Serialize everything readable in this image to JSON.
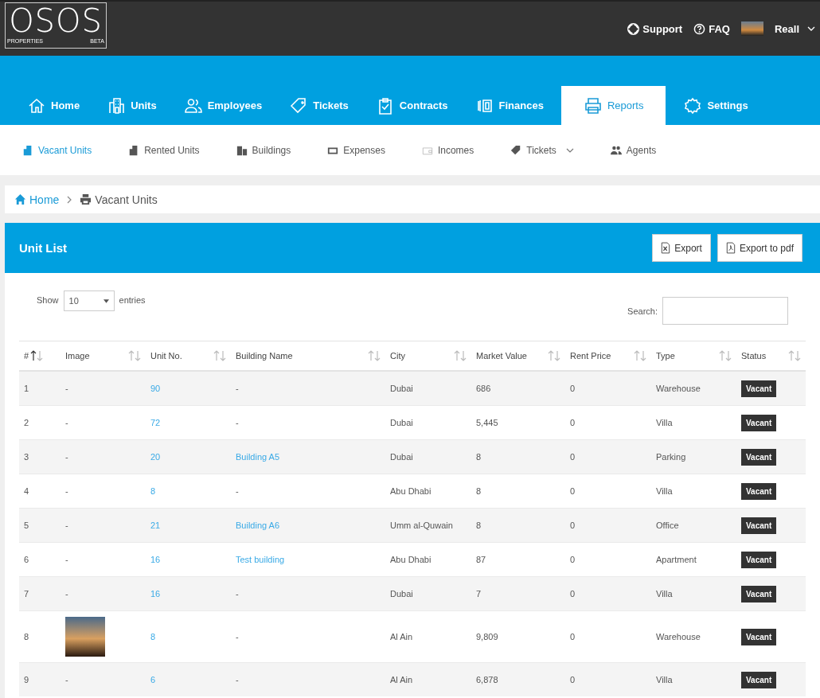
{
  "logo": {
    "name": "OSOS",
    "sub_left": "PROPERTIES",
    "sub_right": "BETA"
  },
  "top_links": [
    {
      "label": "Support"
    },
    {
      "label": "FAQ"
    }
  ],
  "user": {
    "name": "Reall"
  },
  "nav": [
    {
      "label": "Home",
      "selected": false
    },
    {
      "label": "Units",
      "selected": false
    },
    {
      "label": "Employees",
      "selected": false
    },
    {
      "label": "Tickets",
      "selected": false
    },
    {
      "label": "Contracts",
      "selected": false
    },
    {
      "label": "Finances",
      "selected": false
    },
    {
      "label": "Reports",
      "selected": true
    },
    {
      "label": "Settings",
      "selected": false
    }
  ],
  "subnav": [
    {
      "label": "Vacant Units",
      "selected": true,
      "dropdown": false
    },
    {
      "label": "Rented Units",
      "selected": false,
      "dropdown": false
    },
    {
      "label": "Buildings",
      "selected": false,
      "dropdown": false
    },
    {
      "label": "Expenses",
      "selected": false,
      "dropdown": false
    },
    {
      "label": "Incomes",
      "selected": false,
      "dropdown": false
    },
    {
      "label": "Tickets",
      "selected": false,
      "dropdown": true
    },
    {
      "label": "Agents",
      "selected": false,
      "dropdown": false
    }
  ],
  "breadcrumb": [
    {
      "label": "Home"
    },
    {
      "label": "Vacant Units"
    }
  ],
  "panel": {
    "title": "Unit List",
    "buttons": [
      {
        "label": "Export"
      },
      {
        "label": "Export to pdf"
      }
    ]
  },
  "length": {
    "before": "Show",
    "value": "10",
    "after": "entries"
  },
  "search": {
    "label": "Search:"
  },
  "table": {
    "columns": [
      {
        "label": "#",
        "sort_active": true
      },
      {
        "label": "Image",
        "sort_active": false
      },
      {
        "label": "Unit No.",
        "sort_active": false
      },
      {
        "label": "Building Name",
        "sort_active": false
      },
      {
        "label": "City",
        "sort_active": false
      },
      {
        "label": "Market Value",
        "sort_active": false
      },
      {
        "label": "Rent Price",
        "sort_active": false
      },
      {
        "label": "Type",
        "sort_active": false
      },
      {
        "label": "Status",
        "sort_active": false
      }
    ],
    "rows": [
      {
        "no": "1",
        "photo": false,
        "image": "-",
        "unit": "90",
        "building": "-",
        "building_linked": false,
        "city": "Dubai",
        "market": "686",
        "rent": "0",
        "type": "Warehouse",
        "status": "Vacant"
      },
      {
        "no": "2",
        "photo": false,
        "image": "-",
        "unit": "72",
        "building": "-",
        "building_linked": false,
        "city": "Dubai",
        "market": "5,445",
        "rent": "0",
        "type": "Villa",
        "status": "Vacant"
      },
      {
        "no": "3",
        "photo": false,
        "image": "-",
        "unit": "20",
        "building": "Building A5",
        "building_linked": true,
        "city": "Dubai",
        "market": "8",
        "rent": "0",
        "type": "Parking",
        "status": "Vacant"
      },
      {
        "no": "4",
        "photo": false,
        "image": "-",
        "unit": "8",
        "building": "-",
        "building_linked": false,
        "city": "Abu Dhabi",
        "market": "8",
        "rent": "0",
        "type": "Villa",
        "status": "Vacant"
      },
      {
        "no": "5",
        "photo": false,
        "image": "-",
        "unit": "21",
        "building": "Building A6",
        "building_linked": true,
        "city": "Umm al-Quwain",
        "market": "8",
        "rent": "0",
        "type": "Office",
        "status": "Vacant"
      },
      {
        "no": "6",
        "photo": false,
        "image": "-",
        "unit": "16",
        "building": "Test building",
        "building_linked": true,
        "city": "Abu Dhabi",
        "market": "87",
        "rent": "0",
        "type": "Apartment",
        "status": "Vacant"
      },
      {
        "no": "7",
        "photo": false,
        "image": "-",
        "unit": "16",
        "building": "-",
        "building_linked": false,
        "city": "Dubai",
        "market": "7",
        "rent": "0",
        "type": "Villa",
        "status": "Vacant"
      },
      {
        "no": "8",
        "photo": true,
        "unit": "8",
        "building": "-",
        "building_linked": false,
        "city": "Al Ain",
        "market": "9,809",
        "rent": "0",
        "type": "Warehouse",
        "status": "Vacant"
      },
      {
        "no": "9",
        "photo": false,
        "image": "-",
        "unit": "6",
        "building": "-",
        "building_linked": false,
        "city": "Al Ain",
        "market": "6,878",
        "rent": "0",
        "type": "Villa",
        "status": "Vacant"
      }
    ]
  }
}
